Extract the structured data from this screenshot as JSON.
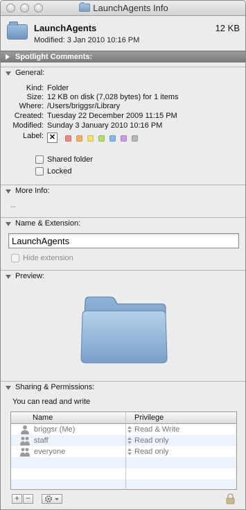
{
  "window": {
    "title": "LaunchAgents Info"
  },
  "header": {
    "name": "LaunchAgents",
    "size": "12 KB",
    "modified": "Modified: 3 Jan 2010 10:16 PM"
  },
  "spotlight": {
    "label": "Spotlight Comments:"
  },
  "general": {
    "label": "General:",
    "rows": [
      {
        "label": "Kind:",
        "value": "Folder"
      },
      {
        "label": "Size:",
        "value": "12 KB on disk (7,028 bytes) for 1 items"
      },
      {
        "label": "Where:",
        "value": "/Users/briggsr/Library"
      },
      {
        "label": "Created:",
        "value": "Tuesday 22 December 2009 11:15 PM"
      },
      {
        "label": "Modified:",
        "value": "Sunday 3 January 2010 10:16 PM"
      }
    ],
    "label_label": "Label:",
    "label_none": "✕",
    "label_colors": [
      "#f08a80",
      "#f5b25e",
      "#f3e36a",
      "#b8de6a",
      "#85b8f2",
      "#c99be3",
      "#b8b8b8"
    ],
    "shared_folder": "Shared folder",
    "locked": "Locked"
  },
  "more_info": {
    "label": "More Info:",
    "value": "--"
  },
  "name_ext": {
    "label": "Name & Extension:",
    "name_value": "LaunchAgents",
    "hide_extension": "Hide extension"
  },
  "preview": {
    "label": "Preview:"
  },
  "sharing": {
    "label": "Sharing & Permissions:",
    "intro": "You can read and write",
    "col_name": "Name",
    "col_priv": "Privilege",
    "rows": [
      {
        "name": "briggsr (Me)",
        "privilege": "Read & Write",
        "icon": "user-icon"
      },
      {
        "name": "staff",
        "privilege": "Read only",
        "icon": "group-icon"
      },
      {
        "name": "everyone",
        "privilege": "Read only",
        "icon": "group-icon"
      }
    ],
    "add": "+",
    "remove": "−"
  }
}
